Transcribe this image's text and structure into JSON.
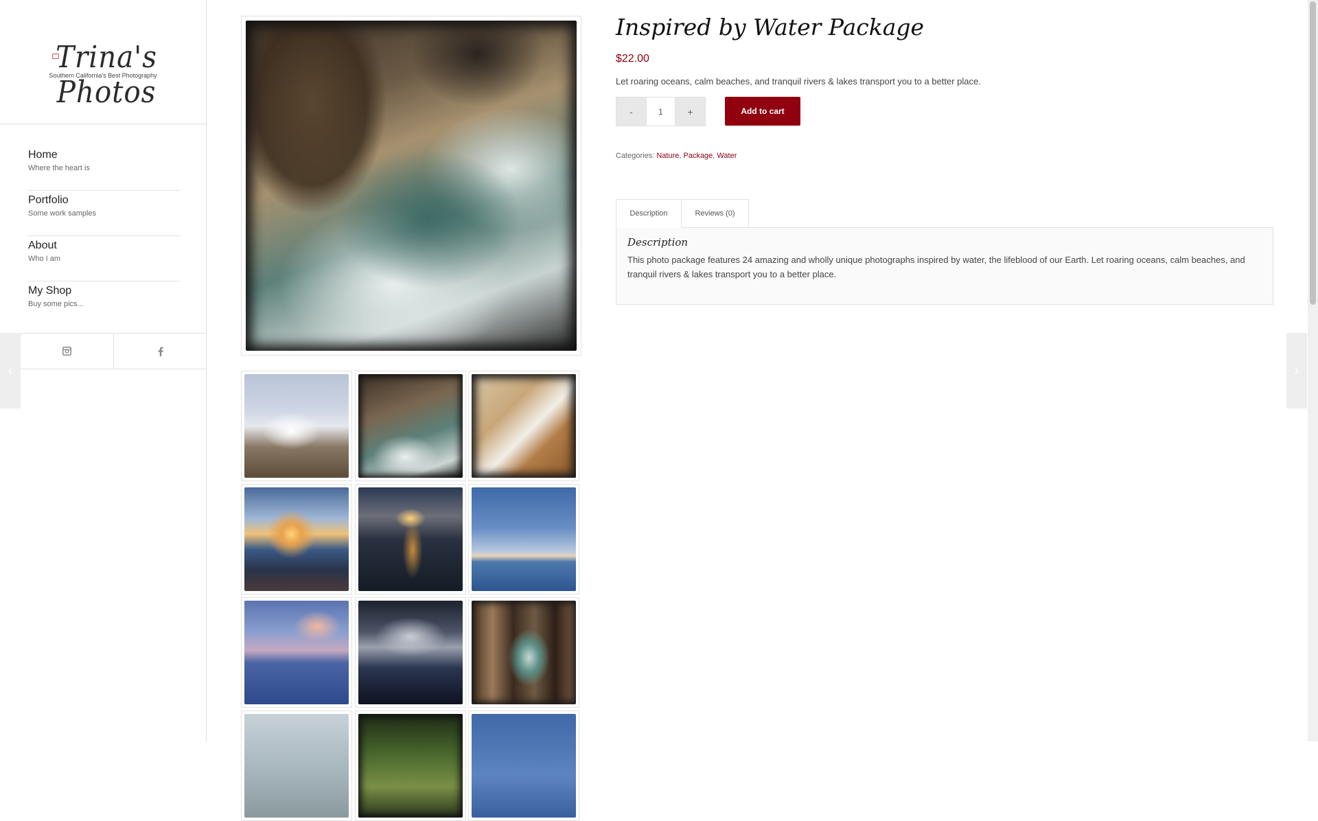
{
  "brand": {
    "name": "Trina's Photos",
    "tagline": "Southern California's Best Photography"
  },
  "nav": [
    {
      "title": "Home",
      "subtitle": "Where the heart is"
    },
    {
      "title": "Portfolio",
      "subtitle": "Some work samples"
    },
    {
      "title": "About",
      "subtitle": "Who I am"
    },
    {
      "title": "My Shop",
      "subtitle": "Buy some pics..."
    }
  ],
  "social": [
    "instagram-icon",
    "facebook-icon"
  ],
  "product": {
    "title": "Inspired by Water Package",
    "price": "$22.00",
    "short_description": "Let roaring oceans, calm beaches, and tranquil rivers & lakes transport you to a better place.",
    "quantity": "1",
    "qty_minus": "-",
    "qty_plus": "+",
    "add_to_cart": "Add to cart",
    "categories_label": "Categories:",
    "categories": [
      "Nature",
      "Package",
      "Water"
    ]
  },
  "tabs": {
    "description_tab": "Description",
    "reviews_tab": "Reviews (0)",
    "panel_heading": "Description",
    "panel_text": "This photo package features 24 amazing and wholly unique photographs inspired by water, the lifeblood of our Earth. Let roaring oceans, calm beaches, and tranquil rivers & lakes transport you to a better place."
  },
  "arrows": {
    "prev": "‹",
    "next": "›"
  },
  "colors": {
    "accent": "#90000f",
    "price": "#8b0011",
    "border": "#e1e1e1"
  }
}
